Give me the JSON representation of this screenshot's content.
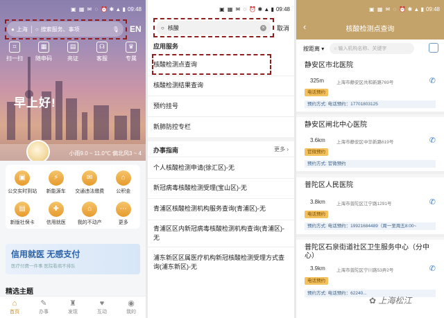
{
  "status_time": "09:48",
  "status_icons": "▣ ▦ ✉ ◌",
  "status_right": "⏰ ✱ ▲ ▮",
  "panel1": {
    "location": "上海",
    "search_placeholder": "搜索服务、事项",
    "lang": "EN",
    "quick": [
      "扫一扫",
      "随申码",
      "亮证",
      "客服",
      "专属"
    ],
    "greeting": "早上好!",
    "weather": "小雨9.0 ~ 11.0℃ 偏北风3 ~ 4",
    "services": [
      {
        "label": "公交实时到站",
        "icon": "▣"
      },
      {
        "label": "新能源车",
        "icon": "⚡"
      },
      {
        "label": "交通违法缴费",
        "icon": "✉"
      },
      {
        "label": "公积金",
        "icon": "⌂"
      },
      {
        "label": "新版社保卡",
        "icon": "▤"
      },
      {
        "label": "信用就医",
        "icon": "✚"
      },
      {
        "label": "我的不动产",
        "icon": "⌂"
      },
      {
        "label": "更多",
        "icon": "⋯"
      }
    ],
    "banner_title": "信用就医  无感支付",
    "banner_sub": "医疗付费一件事   医院看病不排队",
    "featured": "精选主题",
    "tabs": [
      {
        "label": "首页",
        "icon": "⌂"
      },
      {
        "label": "办事",
        "icon": "✎"
      },
      {
        "label": "发现",
        "icon": "♜"
      },
      {
        "label": "互动",
        "icon": "♥"
      },
      {
        "label": "我的",
        "icon": "◉"
      }
    ]
  },
  "panel2": {
    "query": "核酸",
    "cancel": "取消",
    "section_app": "应用服务",
    "apps": [
      "核酸检测点查询",
      "核酸检测结果查询",
      "预约挂号",
      "新肺防控专栏"
    ],
    "section_guide": "办事指南",
    "more": "更多",
    "guides": [
      "个人核酸检测申请(徐汇区)-无",
      "新冠病毒核酸检测受理(宝山区)-无",
      "青浦区核酸检测机构服务查询(青浦区)-无",
      "青浦区区内新冠病毒核酸检测机构查询(青浦区)-无",
      "浦东新区区属医疗机构新冠核酸检测受理方式查询(浦东新区)-无"
    ]
  },
  "panel3": {
    "title": "核酸检测点查询",
    "sort": "按距离",
    "search_placeholder": "输入机构名称、关键字",
    "cards": [
      {
        "name": "静安区市北医院",
        "distance": "325m",
        "address": "上海市静安区共和新路769号",
        "tag": "电话预约",
        "booking": "预约方式:  电话预约：17701803125"
      },
      {
        "name": "静安区闸北中心医院",
        "distance": "3.6km",
        "address": "上海市静安区中华新路619号",
        "tag": "官微预约",
        "booking": "预约方式:  官微预约"
      },
      {
        "name": "普陀区人民医院",
        "distance": "3.8km",
        "address": "上海市普陀区江宁路1291号",
        "tag": "电话预约",
        "booking": "预约方式:  电话预约：19921684489（周一至周五8:00~"
      },
      {
        "name": "普陀区石泉街道社区卫生服务中心（分中心）",
        "distance": "3.9km",
        "address": "上海市普陀区宁川路53弄2号",
        "tag": "电话预约",
        "booking": "预约方式:  电话预约：62240..."
      }
    ]
  },
  "watermark": "上海松江"
}
